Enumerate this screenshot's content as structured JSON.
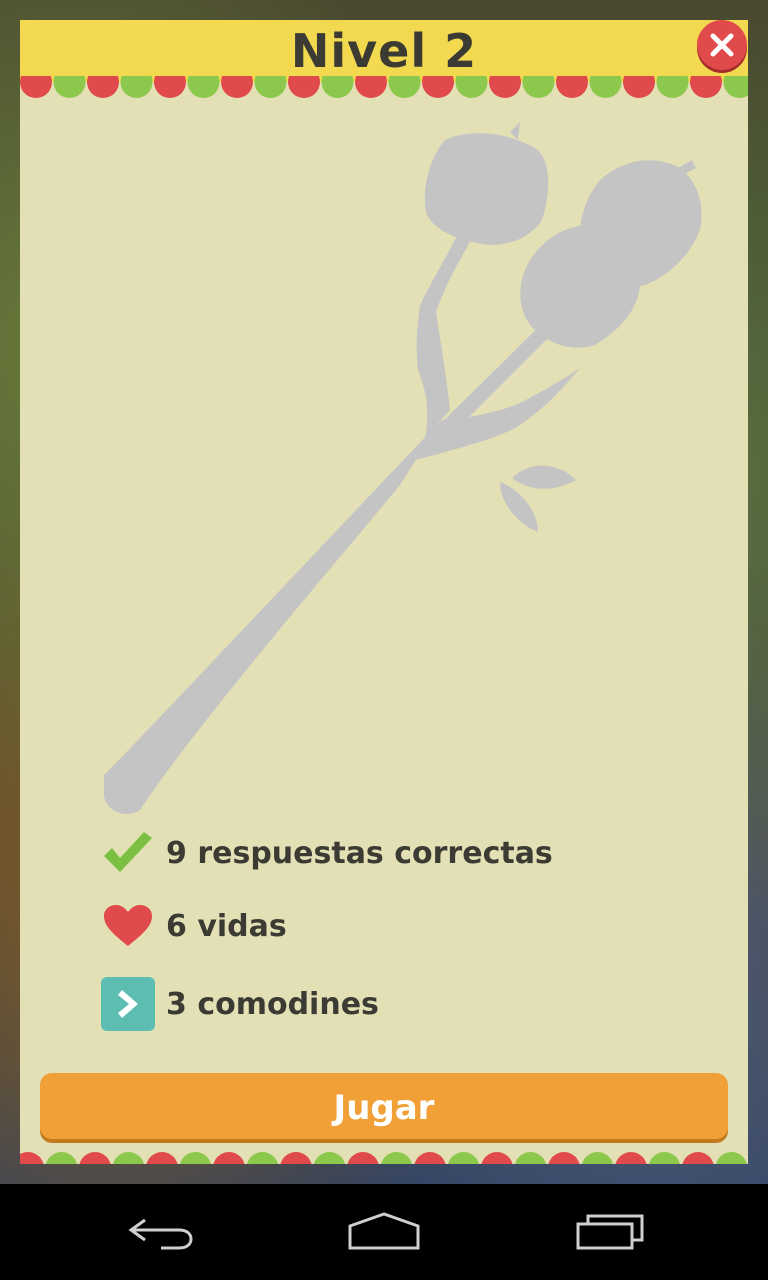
{
  "modal": {
    "title": "Nivel 2",
    "close_icon": "close-icon",
    "silhouette": "marshmallow-stick-silhouette"
  },
  "stats": [
    {
      "icon": "check-icon",
      "text": "9 respuestas correctas"
    },
    {
      "icon": "heart-icon",
      "text": "6 vidas"
    },
    {
      "icon": "skip-icon",
      "text": "3 comodines"
    }
  ],
  "play_button": {
    "label": "Jugar"
  },
  "navbar": {
    "back_icon": "back-icon",
    "home_icon": "home-icon",
    "recents_icon": "recents-icon"
  },
  "colors": {
    "header": "#f3d94f",
    "panel": "#e4e0b6",
    "scallop_red": "#e04a4a",
    "scallop_green": "#8cc84b",
    "play": "#f0a036",
    "close": "#e04a4a",
    "check": "#7bc043",
    "heart": "#e04a4a",
    "skip": "#5dbdb0",
    "silhouette": "#c4c4c4"
  }
}
